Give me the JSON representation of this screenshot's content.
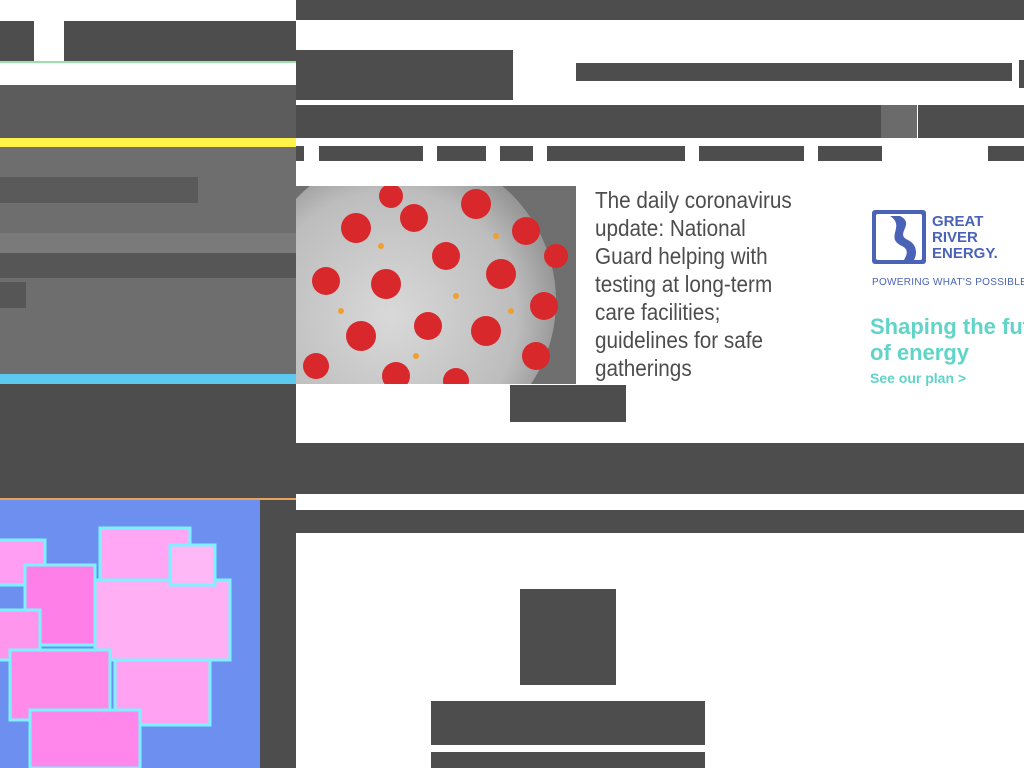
{
  "article": {
    "headline": "The daily coronavirus update: National Guard helping with testing at long-term care facilities; guidelines for safe gatherings"
  },
  "ad": {
    "brand": "GREAT RIVER ENERGY.",
    "tagline": "POWERING WHAT'S POSSIBLE",
    "headline": "Shaping the future of energy",
    "cta": "See our plan >"
  },
  "nav": {
    "sub_items": [
      "",
      "",
      "",
      "",
      "",
      "",
      "",
      ""
    ]
  },
  "colors": {
    "overlay_gray": "#4d4d4d",
    "ad_blue": "#4a63b7",
    "ad_teal": "#5fd4c7",
    "virus_red": "#d8282b",
    "accent_yellow": "#fff24a",
    "accent_cyan": "#5ccaf0"
  }
}
